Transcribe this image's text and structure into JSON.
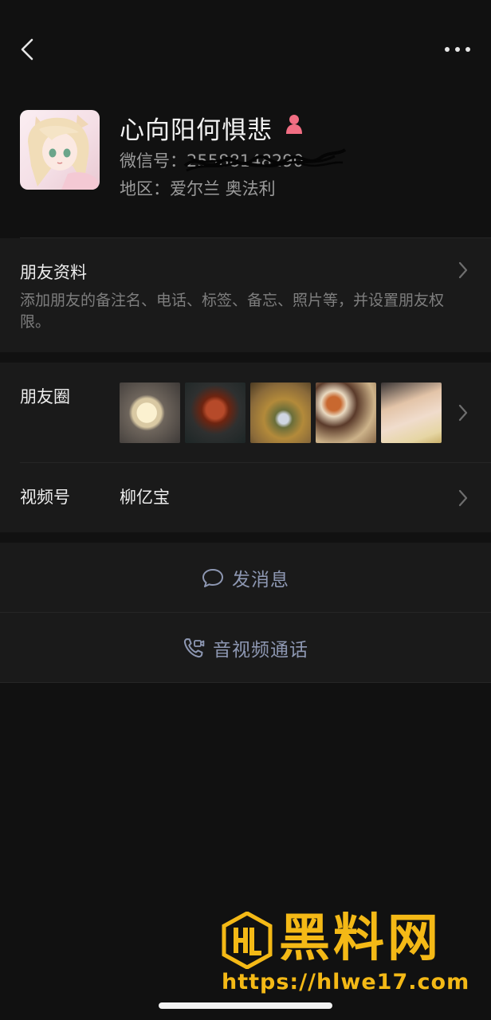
{
  "profile": {
    "name": "心向阳何惧悲",
    "gender_icon": "female-icon",
    "gender_color": "#f26e83",
    "wechat_id_label": "微信号：",
    "wechat_id_value": "25588148290",
    "region_label": "地区：",
    "region_value": "爱尔兰 奥法利"
  },
  "friend_info": {
    "title": "朋友资料",
    "description": "添加朋友的备注名、电话、标签、备忘、照片等，并设置朋友权限。"
  },
  "moments": {
    "label": "朋友圈"
  },
  "channels": {
    "label": "视频号",
    "value": "柳亿宝"
  },
  "actions": {
    "send_message": "发消息",
    "voice_video_call": "音视频通话"
  },
  "watermark": {
    "title": "黑料网",
    "url": "https://hlwe17.com",
    "color": "#f4b916"
  },
  "colors": {
    "background": "#111111",
    "card": "#1a1a1a",
    "action_text": "#8d97b2"
  }
}
